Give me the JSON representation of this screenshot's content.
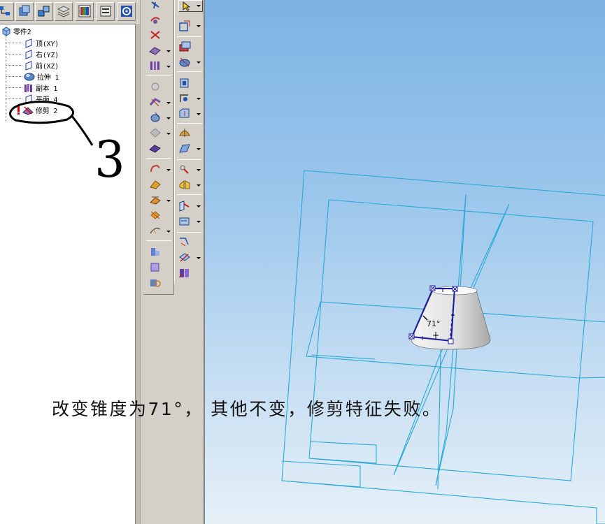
{
  "feature_tree": {
    "root": "零件2",
    "items": [
      {
        "label": "顶(XY)",
        "icon": "plane-icon"
      },
      {
        "label": "右(YZ)",
        "icon": "plane-icon"
      },
      {
        "label": "前(XZ)",
        "icon": "plane-icon"
      },
      {
        "label": "拉伸 1",
        "icon": "extrude-icon"
      },
      {
        "label": "副本 1",
        "icon": "copy-icon"
      },
      {
        "label": "平面 4",
        "icon": "plane-icon"
      },
      {
        "label": "修剪 2",
        "icon": "trim-icon",
        "status": "error"
      }
    ]
  },
  "viewport": {
    "dimension_label": "71°"
  },
  "annotation": {
    "handwritten_number": "3",
    "caption": "改变锥度为71°， 其他不变，修剪特征失败。"
  },
  "colors": {
    "sketch_blue": "#1a1aa0",
    "plane_cyan": "#2aa8d8",
    "error_red": "#e00000"
  }
}
